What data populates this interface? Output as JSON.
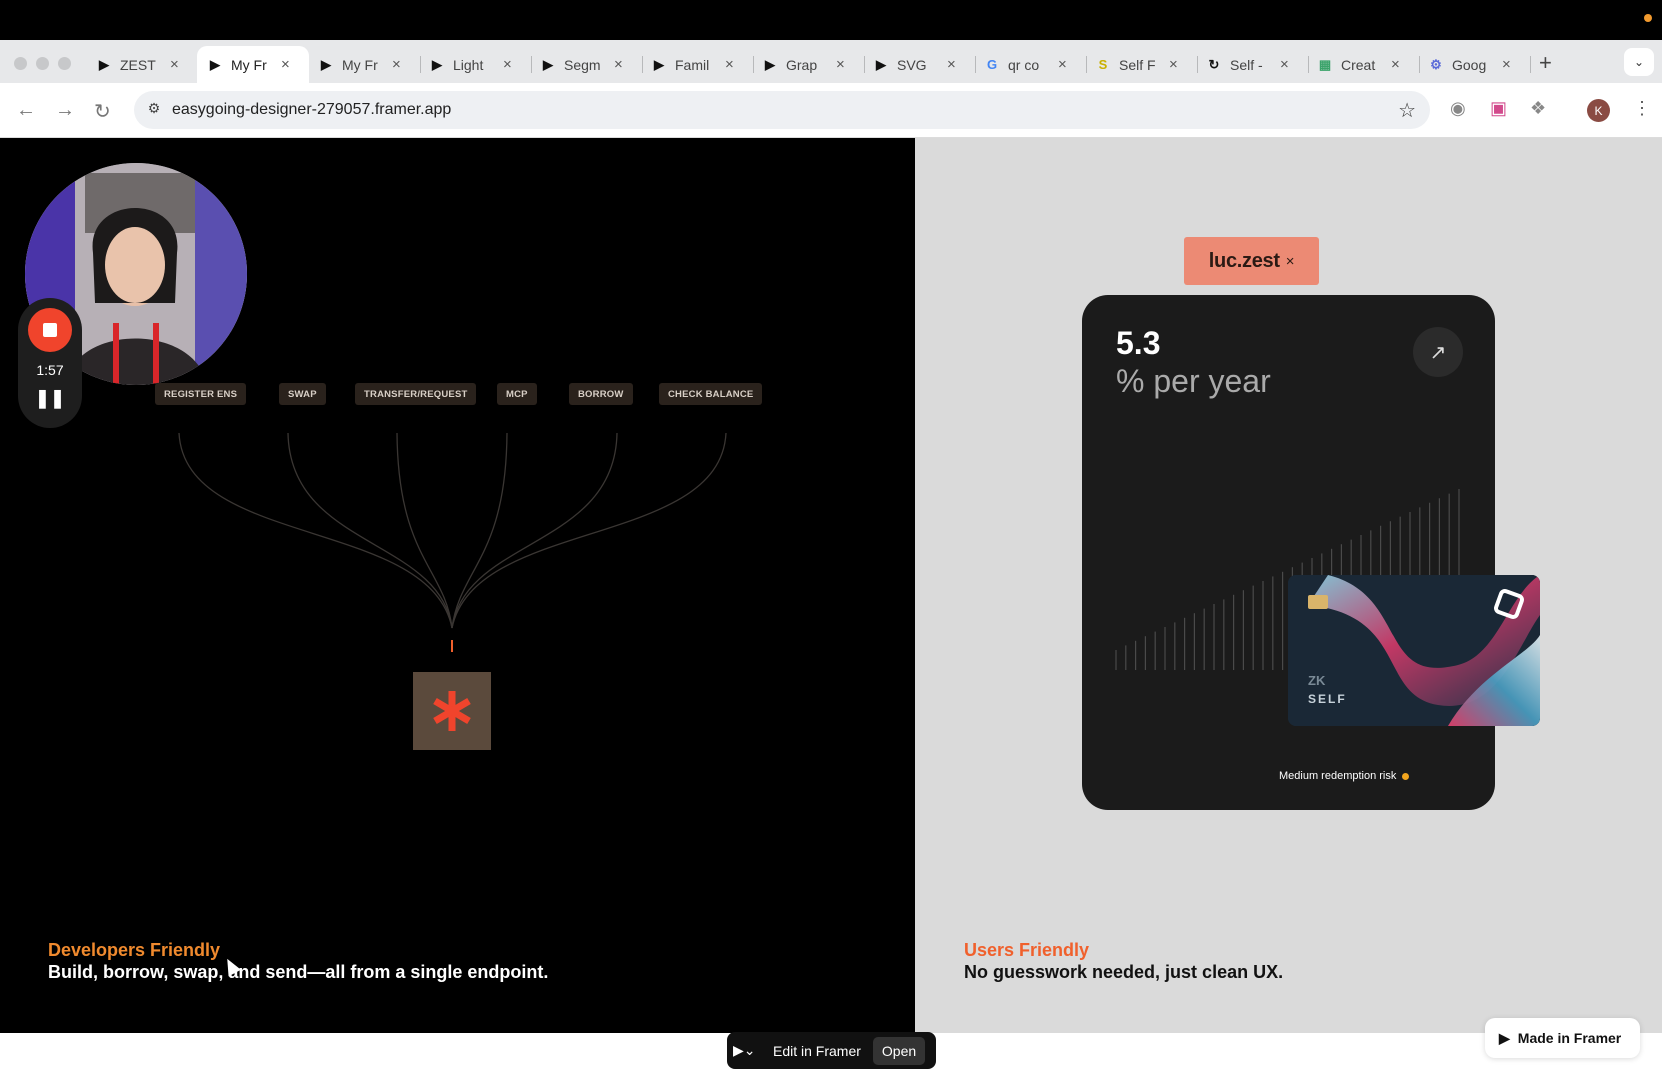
{
  "browser": {
    "tabs": [
      {
        "label": "ZEST",
        "favicon": "framer-icon"
      },
      {
        "label": "My Fr",
        "favicon": "framer-icon",
        "active": true
      },
      {
        "label": "My Fr",
        "favicon": "framer-icon"
      },
      {
        "label": "Light",
        "favicon": "framer-icon"
      },
      {
        "label": "Segm",
        "favicon": "framer-icon"
      },
      {
        "label": "Famil",
        "favicon": "framer-icon"
      },
      {
        "label": "Grap",
        "favicon": "framer-icon"
      },
      {
        "label": "SVG",
        "favicon": "framer-icon"
      },
      {
        "label": "qr co",
        "favicon": "google-icon"
      },
      {
        "label": "Self F",
        "favicon": "self-yellow-icon"
      },
      {
        "label": "Self -",
        "favicon": "self-icon"
      },
      {
        "label": "Creat",
        "favicon": "qr-icon"
      },
      {
        "label": "Goog",
        "favicon": "gear-icon"
      }
    ],
    "url": "easygoing-designer-279057.framer.app",
    "profile_initial": "K"
  },
  "left": {
    "actions": [
      "REGISTER ENS",
      "SWAP",
      "TRANSFER/REQUEST",
      "MCP",
      "BORROW",
      "CHECK BALANCE"
    ],
    "recording_time": "1:57",
    "caption_title": "Developers Friendly",
    "caption_body": "Build, borrow, swap, and send—all from a single endpoint.",
    "accent": "#f08a2e"
  },
  "right": {
    "tag_label": "luc.zest",
    "tag_close": "×",
    "rate_value": "5.3",
    "rate_unit": "% per year",
    "risk_label": "Medium redemption risk",
    "card_brand": "SELF",
    "card_chip_text": "ZK",
    "caption_title": "Users Friendly",
    "caption_body": "No guesswork needed, just clean UX.",
    "accent": "#f0602c"
  },
  "framer": {
    "edit_label": "Edit in Framer",
    "open_label": "Open",
    "made_in_label": "Made in Framer"
  }
}
